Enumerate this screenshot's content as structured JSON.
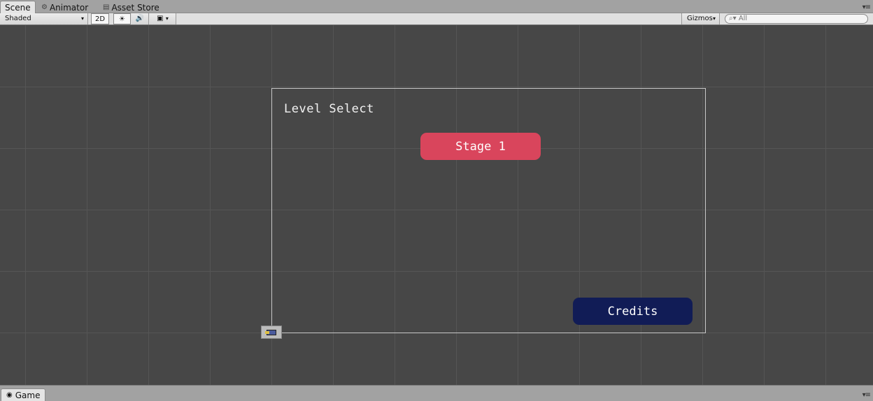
{
  "tabs": [
    {
      "label": "Scene",
      "icon": "scene-icon"
    },
    {
      "label": "Animator",
      "icon": "animator-icon"
    },
    {
      "label": "Asset Store",
      "icon": "asset-store-icon"
    }
  ],
  "toolbar": {
    "shading_mode": "Shaded",
    "mode_2d": "2D",
    "gizmos_label": "Gizmos",
    "search_placeholder": "All"
  },
  "scene": {
    "title_text": "Level Select",
    "stage_button_label": "Stage 1",
    "credits_button_label": "Credits",
    "colors": {
      "stage_button": "#d9455c",
      "credits_button": "#111c56",
      "background": "#474747"
    }
  },
  "bottom_tab": {
    "label": "Game",
    "icon": "game-icon"
  }
}
